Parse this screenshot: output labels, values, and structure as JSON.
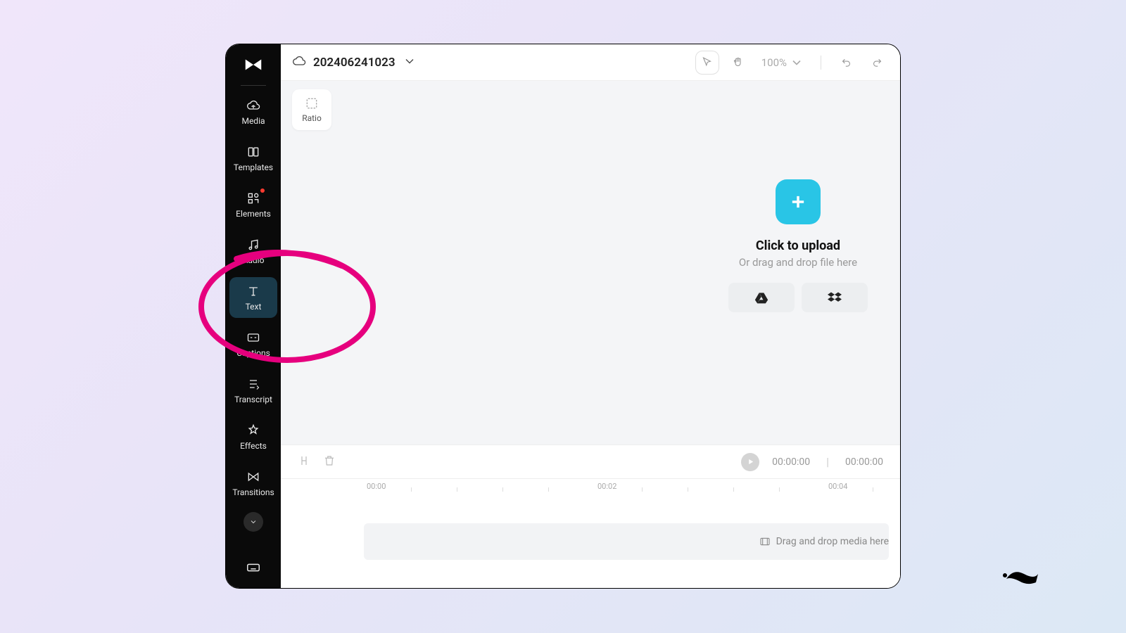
{
  "header": {
    "project_name": "202406241023",
    "zoom": "100%"
  },
  "sidebar": {
    "items": [
      {
        "label": "Media"
      },
      {
        "label": "Templates"
      },
      {
        "label": "Elements"
      },
      {
        "label": "Audio"
      },
      {
        "label": "Text"
      },
      {
        "label": "Captions"
      },
      {
        "label": "Transcript"
      },
      {
        "label": "Effects"
      },
      {
        "label": "Transitions"
      }
    ],
    "active_index": 4
  },
  "canvas": {
    "ratio_label": "Ratio",
    "upload_title": "Click to upload",
    "upload_subtitle": "Or drag and drop file here"
  },
  "timeline": {
    "current_time": "00:00:00",
    "total_time": "00:00:00",
    "ruler_marks": [
      "00:00",
      "00:02",
      "00:04"
    ],
    "track_hint": "Drag and drop media here"
  },
  "annotation": {
    "color": "#e6007e"
  }
}
